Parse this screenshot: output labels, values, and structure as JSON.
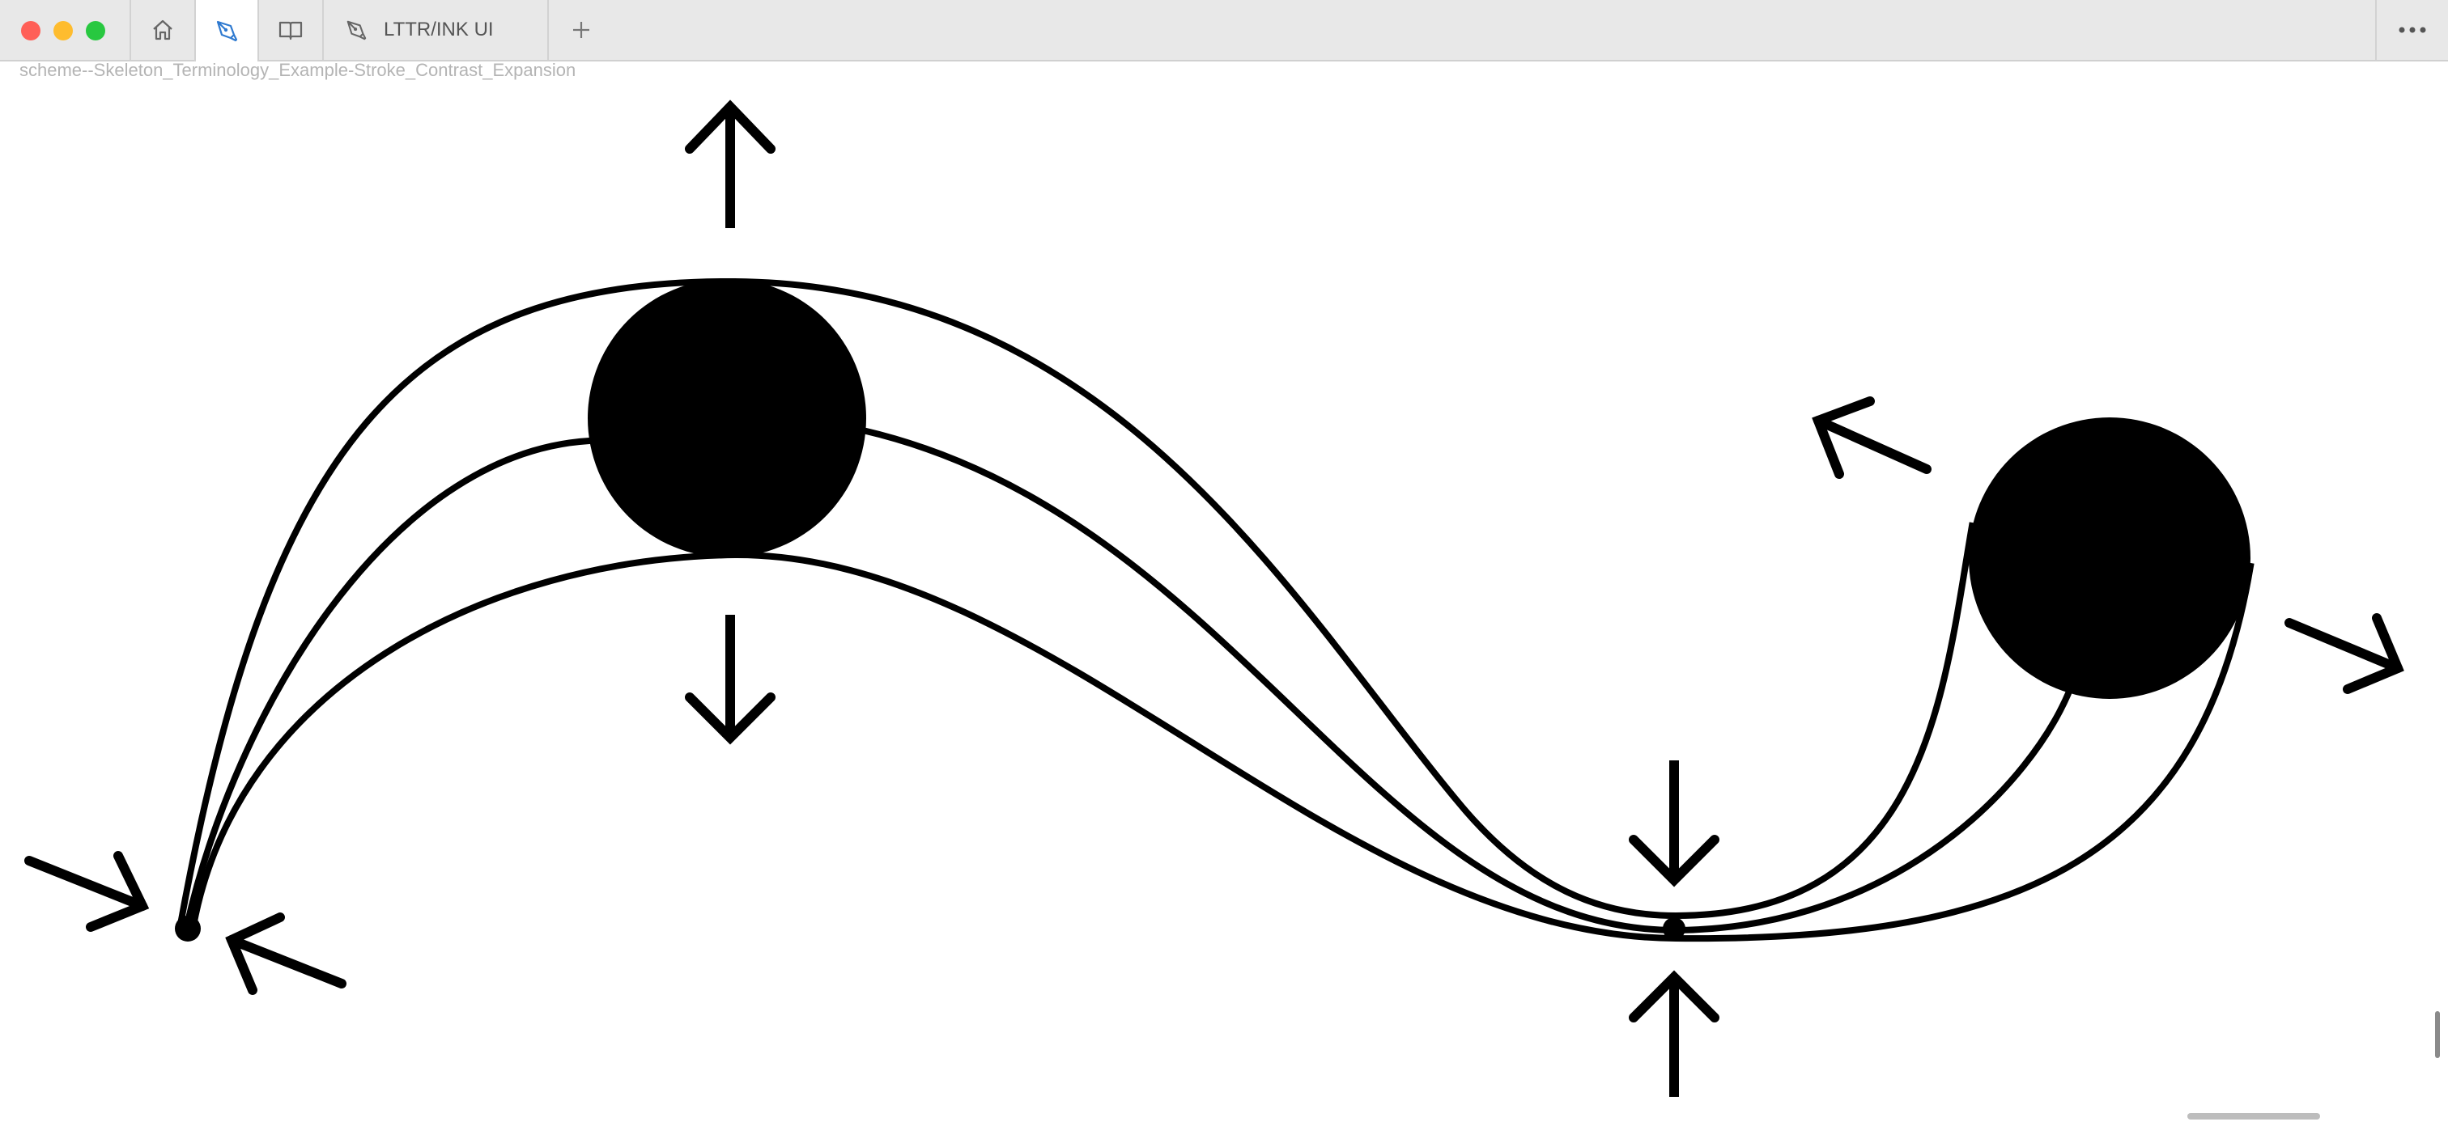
{
  "window": {
    "tabs": [
      {
        "icon": "home-icon"
      },
      {
        "icon": "pen-nib-icon",
        "active": true
      },
      {
        "icon": "book-icon"
      },
      {
        "icon": "pen-nib-icon",
        "label": "LTTR/INK UI"
      }
    ],
    "new_tab_icon": "plus-icon",
    "more_icon": "ellipsis-icon"
  },
  "document": {
    "name": "scheme--Skeleton_Terminology_Example-Stroke_Contrast_Expansion"
  },
  "colors": {
    "ink": "#000000",
    "titlebar": "#e8e8e8",
    "accent": "#2f7ad0",
    "close": "#ff5f57",
    "minimize": "#febc2e",
    "zoom": "#28c840"
  }
}
